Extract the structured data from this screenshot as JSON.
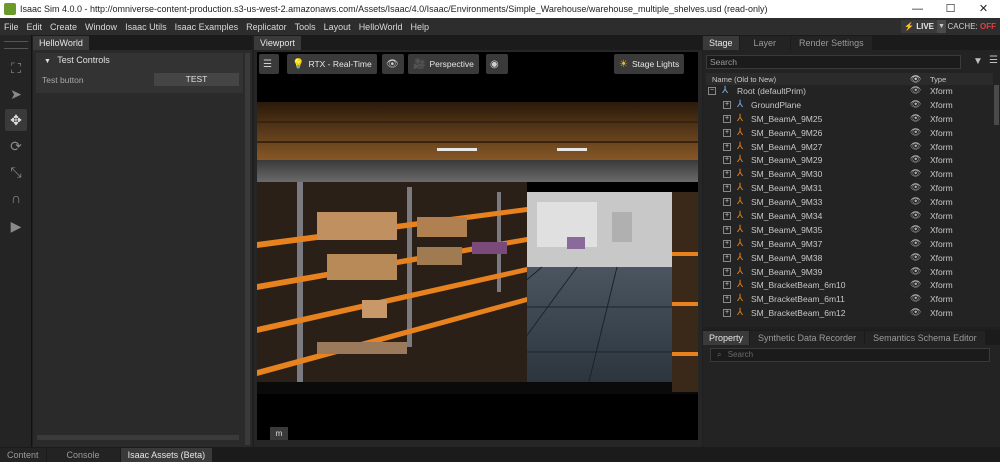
{
  "window": {
    "title": "Isaac Sim 4.0.0 - http://omniverse-content-production.s3-us-west-2.amazonaws.com/Assets/Isaac/4.0/Isaac/Environments/Simple_Warehouse/warehouse_multiple_shelves.usd (read-only)",
    "minimize": "—",
    "maximize": "☐",
    "close": "✕"
  },
  "menu": [
    "File",
    "Edit",
    "Create",
    "Window",
    "Isaac Utils",
    "Isaac Examples",
    "Replicator",
    "Tools",
    "Layout",
    "HelloWorld",
    "Help"
  ],
  "status": {
    "live": "LIVE",
    "cache_label": "CACHE:",
    "cache_value": "OFF"
  },
  "hello_world": {
    "tab": "HelloWorld",
    "frame_title": "Test Controls",
    "row_label": "Test button",
    "button": "TEST"
  },
  "viewport": {
    "tab": "Viewport",
    "renderer": "RTX - Real-Time",
    "camera": "Perspective",
    "lights": "Stage Lights",
    "corner_label": "m"
  },
  "stage": {
    "tabs": [
      "Stage",
      "Layer",
      "Render Settings"
    ],
    "search_placeholder": "Search",
    "col_name": "Name (Old to New)",
    "col_type": "Type",
    "rows": [
      {
        "name": "Root (defaultPrim)",
        "type": "Xform",
        "expander": "⊟"
      },
      {
        "name": "GroundPlane",
        "type": "Xform",
        "expander": "⊞"
      },
      {
        "name": "SM_BeamA_9M25",
        "type": "Xform",
        "expander": "⊞"
      },
      {
        "name": "SM_BeamA_9M26",
        "type": "Xform",
        "expander": "⊞"
      },
      {
        "name": "SM_BeamA_9M27",
        "type": "Xform",
        "expander": "⊞"
      },
      {
        "name": "SM_BeamA_9M29",
        "type": "Xform",
        "expander": "⊞"
      },
      {
        "name": "SM_BeamA_9M30",
        "type": "Xform",
        "expander": "⊞"
      },
      {
        "name": "SM_BeamA_9M31",
        "type": "Xform",
        "expander": "⊞"
      },
      {
        "name": "SM_BeamA_9M33",
        "type": "Xform",
        "expander": "⊞"
      },
      {
        "name": "SM_BeamA_9M34",
        "type": "Xform",
        "expander": "⊞"
      },
      {
        "name": "SM_BeamA_9M35",
        "type": "Xform",
        "expander": "⊞"
      },
      {
        "name": "SM_BeamA_9M37",
        "type": "Xform",
        "expander": "⊞"
      },
      {
        "name": "SM_BeamA_9M38",
        "type": "Xform",
        "expander": "⊞"
      },
      {
        "name": "SM_BeamA_9M39",
        "type": "Xform",
        "expander": "⊞"
      },
      {
        "name": "SM_BracketBeam_6m10",
        "type": "Xform",
        "expander": "⊞"
      },
      {
        "name": "SM_BracketBeam_6m11",
        "type": "Xform",
        "expander": "⊞"
      },
      {
        "name": "SM_BracketBeam_6m12",
        "type": "Xform",
        "expander": "⊞"
      }
    ]
  },
  "property": {
    "tabs": [
      "Property",
      "Synthetic Data Recorder",
      "Semantics Schema Editor"
    ],
    "search_placeholder": "Search"
  },
  "bottom_tabs": [
    "Content",
    "Console",
    "Isaac Assets (Beta)"
  ],
  "colors": {
    "accent_orange": "#e8821e",
    "cache_off": "#e04040",
    "panel": "#2a2a2a"
  },
  "icons": {
    "tools": [
      "select-icon",
      "pointer-icon",
      "move-icon",
      "rotate-icon",
      "scale-icon",
      "snap-icon",
      "play-icon"
    ],
    "prim_root": "root-prim-icon",
    "prim_ground": "xform-icon",
    "prim_mesh": "mesh-icon"
  }
}
